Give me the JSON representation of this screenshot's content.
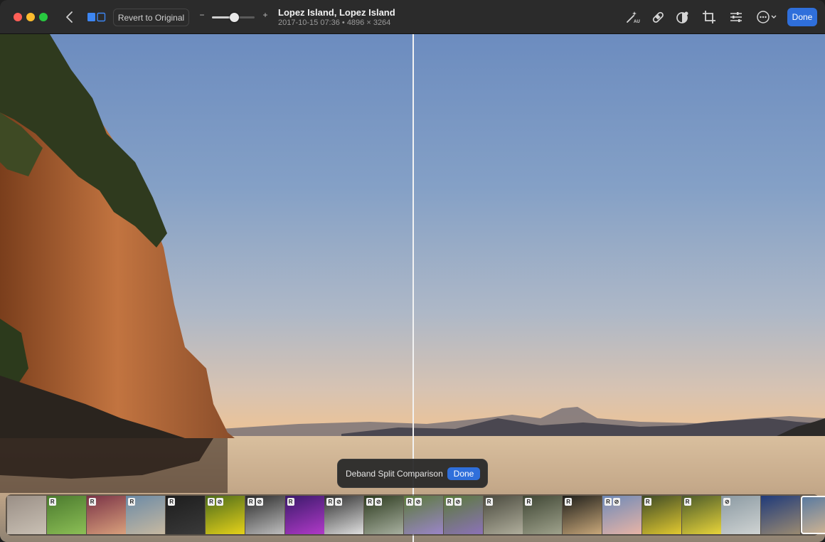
{
  "toolbar": {
    "revert_label": "Revert to Original",
    "zoom_minus": "−",
    "zoom_plus": "+",
    "zoom_level": 0.52,
    "title": "Lopez Island, Lopez Island",
    "subtitle": "2017-10-15 07:36 • 4896 × 3264",
    "done_label": "Done",
    "icons": [
      "auto-enhance-icon",
      "retouch-icon",
      "red-eye-icon",
      "crop-icon",
      "adjust-icon",
      "more-options-icon"
    ]
  },
  "popup": {
    "label": "Deband Split Comparison",
    "done_label": "Done"
  },
  "filmstrip": {
    "badge_r": "R",
    "badge_link": "⊘",
    "thumbs": [
      {
        "colors": [
          "#9a8f86",
          "#c9c0b4"
        ],
        "badges": []
      },
      {
        "colors": [
          "#4b7a2e",
          "#8cbf56"
        ],
        "badges": [
          "R"
        ]
      },
      {
        "colors": [
          "#7a3346",
          "#d9a07c"
        ],
        "badges": [
          "R"
        ]
      },
      {
        "colors": [
          "#6b8aa6",
          "#c7b9a1"
        ],
        "badges": [
          "R"
        ]
      },
      {
        "colors": [
          "#1d1d1d",
          "#3a3a3a"
        ],
        "badges": [
          "R"
        ]
      },
      {
        "colors": [
          "#4c6b1a",
          "#e6d21a"
        ],
        "badges": [
          "R",
          "link"
        ]
      },
      {
        "colors": [
          "#2a2a2a",
          "#bfbfbf"
        ],
        "badges": [
          "R",
          "link"
        ]
      },
      {
        "colors": [
          "#3a1a6a",
          "#b03ac8"
        ],
        "badges": [
          "R"
        ]
      },
      {
        "colors": [
          "#303030",
          "#e0e0e0"
        ],
        "badges": [
          "R",
          "link"
        ]
      },
      {
        "colors": [
          "#2c3a1e",
          "#a8b0a0"
        ],
        "badges": [
          "R",
          "link"
        ]
      },
      {
        "colors": [
          "#5a7a3a",
          "#9b85c9"
        ],
        "badges": [
          "R",
          "link"
        ]
      },
      {
        "colors": [
          "#5a7a3a",
          "#8c72b8"
        ],
        "badges": [
          "R",
          "link"
        ]
      },
      {
        "colors": [
          "#4a4a3e",
          "#b0ae9c"
        ],
        "badges": [
          "R"
        ]
      },
      {
        "colors": [
          "#3f4634",
          "#9fa28c"
        ],
        "badges": [
          "R"
        ]
      },
      {
        "colors": [
          "#1e1e1a",
          "#c9a87a"
        ],
        "badges": [
          "R"
        ]
      },
      {
        "colors": [
          "#6e8ab8",
          "#e8b4a6"
        ],
        "badges": [
          "R",
          "link"
        ]
      },
      {
        "colors": [
          "#3d4a26",
          "#e2c930"
        ],
        "badges": [
          "R"
        ]
      },
      {
        "colors": [
          "#4a5a2a",
          "#e8d43a"
        ],
        "badges": [
          "R"
        ]
      },
      {
        "colors": [
          "#8b9aa3",
          "#cfd3d2"
        ],
        "badges": [
          "link"
        ]
      },
      {
        "colors": [
          "#1f3a7a",
          "#9a8a72"
        ],
        "badges": []
      },
      {
        "colors": [
          "#5a7aa0",
          "#d8b891"
        ],
        "badges": [],
        "selected": true
      }
    ]
  }
}
